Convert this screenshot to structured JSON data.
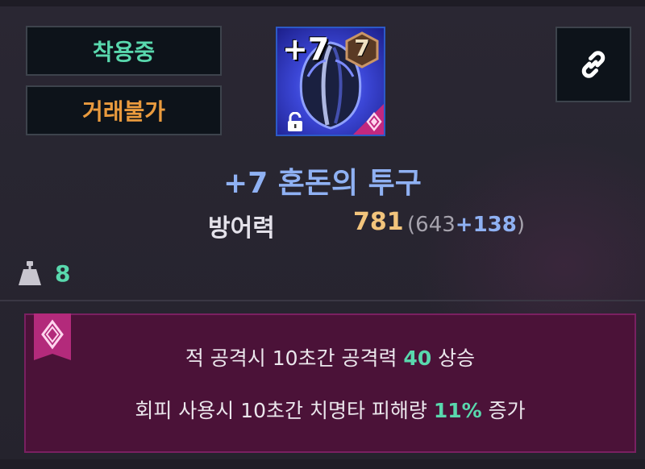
{
  "tags": {
    "equipped": "착용중",
    "untradable": "거래불가"
  },
  "item": {
    "icon": "chaos-helmet-icon",
    "enhance_badge": "+7",
    "grade": "7",
    "name": "+7 혼돈의 투구"
  },
  "stat": {
    "label": "방어력",
    "value": "781",
    "open": "(",
    "base": "643",
    "bonus": "+138",
    "close": ")"
  },
  "weight": {
    "icon": "weight-icon",
    "value": "8"
  },
  "set_effect": {
    "icon": "set-rune-icon",
    "line1": {
      "pre": "적 공격시 10초간 공격력 ",
      "value": "40",
      "post": " 상승"
    },
    "line2": {
      "pre": "회피 사용시 10초간 치명타 피해량 ",
      "value": "11%",
      "post": " 증가"
    }
  },
  "colors": {
    "equipped": "#59d8ad",
    "untradable": "#ea9b3e",
    "item_name": "#8fb1f3",
    "stat_value": "#f2c47c",
    "highlight": "#59d8ad",
    "set_bg": "#4b1238"
  }
}
